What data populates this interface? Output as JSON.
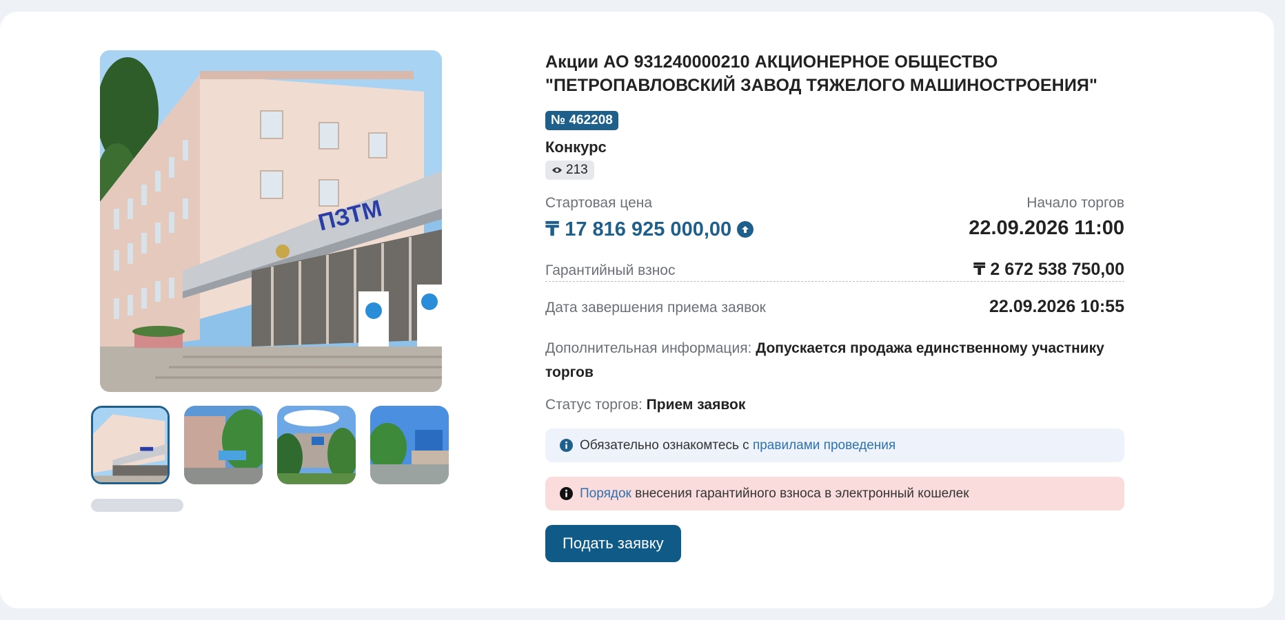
{
  "lot": {
    "title_line1": "Акции АО 931240000210 АКЦИОНЕРНОЕ ОБЩЕСТВО",
    "title_line2": "\"ПЕТРОПАВЛОВСКИЙ ЗАВОД ТЯЖЕЛОГО МАШИНОСТРОЕНИЯ\"",
    "number_badge": "№ 462208",
    "auction_type": "Конкурс",
    "views": "213"
  },
  "pricing": {
    "start_price_label": "Стартовая цена",
    "start_price": "₸ 17 816 925 000,00",
    "start_date_label": "Начало торгов",
    "start_date": "22.09.2026 11:00",
    "guarantee_label": "Гарантийный взнос",
    "guarantee_value": "₸ 2 672 538 750,00",
    "deadline_label": "Дата завершения приема заявок",
    "deadline_value": "22.09.2026 10:55"
  },
  "extra": {
    "label": "Дополнительная информация:",
    "value": "Допускается продажа единственному участнику торгов"
  },
  "status": {
    "label": "Статус торгов:",
    "value": "Прием заявок"
  },
  "notices": {
    "rules_prefix": "Обязательно ознакомтесь с",
    "rules_link": "правилами проведения",
    "order_link": "Порядок",
    "order_suffix": "внесения гарантийного взноса в электронный кошелек"
  },
  "actions": {
    "submit_label": "Подать заявку"
  },
  "gallery": {
    "sign_text": "ПЗТМ",
    "thumbnail_count": 4,
    "active_thumbnail": 1
  },
  "colors": {
    "brand": "#1e5f8c",
    "notice_info_bg": "#edf2fb",
    "notice_warning_bg": "#fbdcdc",
    "link": "#2f71ad"
  }
}
